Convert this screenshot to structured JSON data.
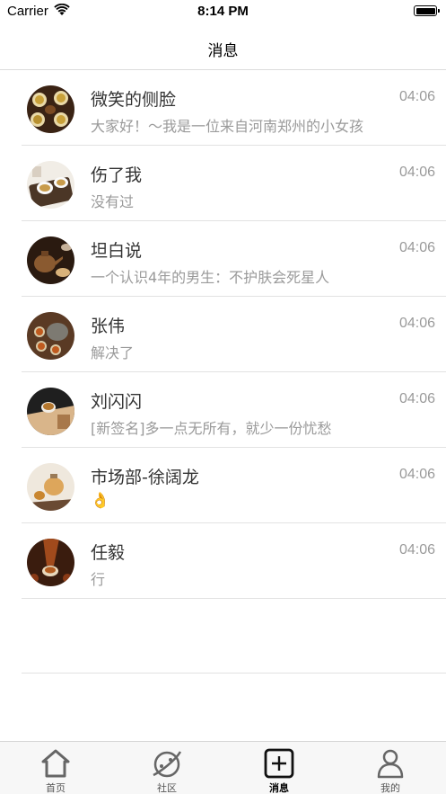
{
  "status_bar": {
    "carrier": "Carrier",
    "time": "8:14 PM"
  },
  "nav": {
    "title": "消息"
  },
  "messages": [
    {
      "name": "微笑的侧脸",
      "preview": "大家好！～我是一位来自河南郑州的小女孩",
      "time": "04:06",
      "avatar": "tea-set-avatar"
    },
    {
      "name": "伤了我",
      "preview": "没有过",
      "time": "04:06",
      "avatar": "tea-cups-avatar"
    },
    {
      "name": "坦白说",
      "preview": "一个认识4年的男生：不护肤会死星人",
      "time": "04:06",
      "avatar": "teapot-avatar"
    },
    {
      "name": "张伟",
      "preview": "解决了",
      "time": "04:06",
      "avatar": "tea-tray-avatar"
    },
    {
      "name": "刘闪闪",
      "preview": "[新签名]多一点无所有，就少一份忧愁",
      "time": "04:06",
      "avatar": "tea-cup-avatar"
    },
    {
      "name": "市场部-徐阔龙",
      "preview": "👌",
      "time": "04:06",
      "avatar": "glass-teapot-avatar"
    },
    {
      "name": "任毅",
      "preview": "行",
      "time": "04:06",
      "avatar": "tea-pour-avatar"
    }
  ],
  "tabs": [
    {
      "label": "首页",
      "icon": "home-icon",
      "active": false
    },
    {
      "label": "社区",
      "icon": "planet-icon",
      "active": false
    },
    {
      "label": "消息",
      "icon": "plus-square-icon",
      "active": true
    },
    {
      "label": "我的",
      "icon": "person-icon",
      "active": false
    }
  ],
  "colors": {
    "text": "#333333",
    "secondary": "#9a9a9a",
    "separator": "#e2e2e2",
    "tabbar": "#f7f7f7"
  }
}
